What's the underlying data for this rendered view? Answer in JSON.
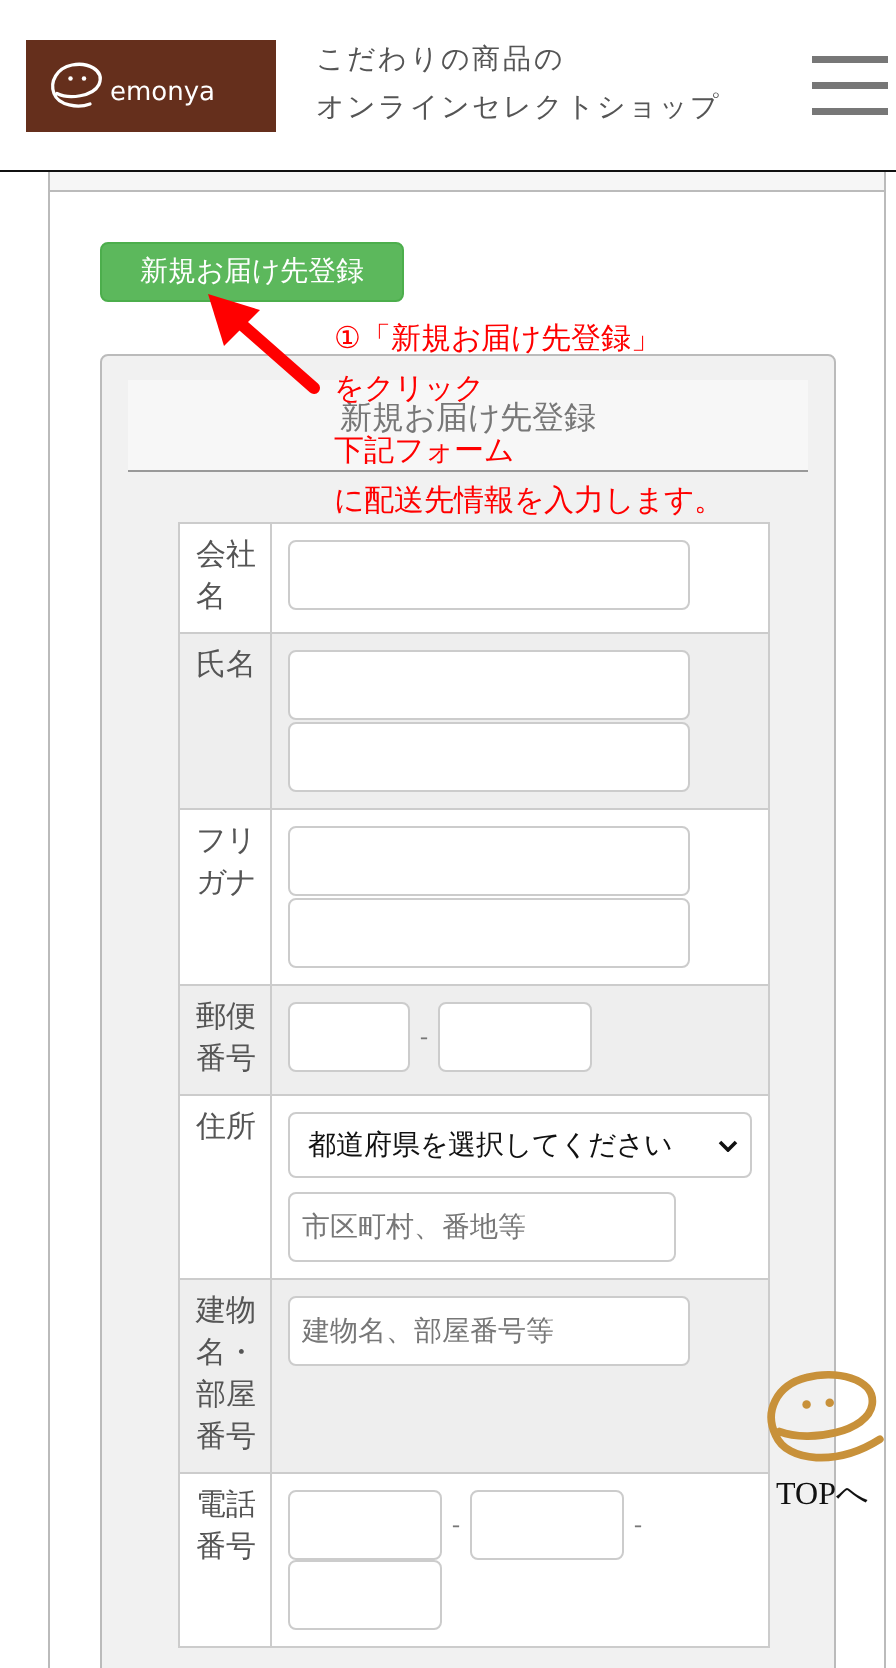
{
  "header": {
    "logo_text": "emonya",
    "tagline": [
      "こだわりの商品の",
      "オンラインセレクトショップ"
    ]
  },
  "new_address_button": "新規お届け先登録",
  "annotation": {
    "lines": [
      "①「新規お届け先登録」",
      "をクリック",
      "下記フォーム",
      "に配送先情報を入力します。"
    ]
  },
  "panel": {
    "title": "新規お届け先登録",
    "rows": [
      {
        "kind": "single",
        "label": "会社名",
        "shaded": false
      },
      {
        "kind": "double",
        "label": "氏名",
        "shaded": true
      },
      {
        "kind": "double",
        "label": "フリガナ",
        "shaded": false
      },
      {
        "kind": "postal",
        "label": "郵便番号",
        "shaded": true,
        "separator": "-"
      },
      {
        "kind": "address",
        "label": "住所",
        "shaded": false,
        "select": "都道府県を選択してください",
        "placeholder": "市区町村、番地等"
      },
      {
        "kind": "single",
        "label": "建物名・部屋番号",
        "shaded": true,
        "placeholder": "建物名、部屋番号等"
      },
      {
        "kind": "phone",
        "label": "電話番号",
        "shaded": false,
        "separator": "-"
      }
    ]
  },
  "top_link": "TOPへ"
}
